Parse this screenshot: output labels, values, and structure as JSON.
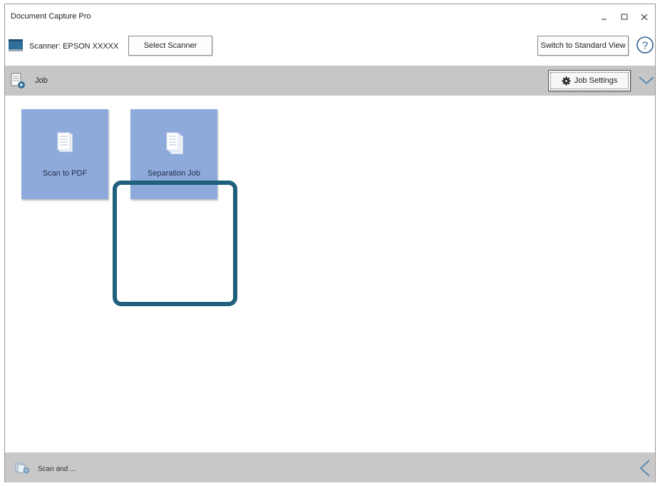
{
  "window": {
    "title": "Document Capture Pro"
  },
  "scanner": {
    "label": "Scanner: EPSON XXXXX",
    "select_button": "Select Scanner"
  },
  "toolbar": {
    "switch_view_button": "Switch to Standard View",
    "help_icon": "help-icon"
  },
  "job_bar": {
    "label": "Job",
    "settings_button": "Job Settings"
  },
  "jobs": [
    {
      "label": "Scan to PDF",
      "selected": false
    },
    {
      "label": "Separation Job",
      "selected": true
    }
  ],
  "bottom_bar": {
    "label": "Scan and ..."
  },
  "colors": {
    "tile": "#8eaadb",
    "highlight": "#1e5f7b",
    "bar": "#c6c6c6"
  }
}
